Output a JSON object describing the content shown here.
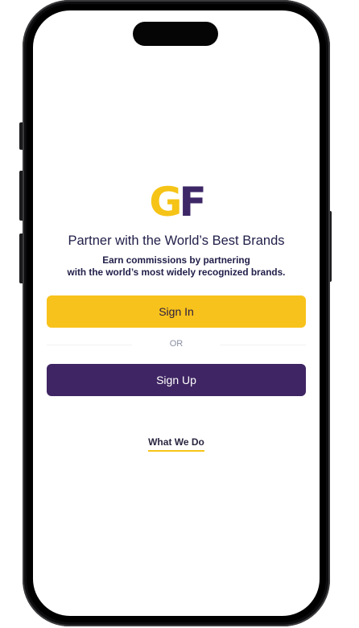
{
  "app": {
    "logo": {
      "letter_1": "G",
      "letter_2": "F"
    },
    "headline": "Partner with the World’s Best Brands",
    "subheadline_line_1": "Earn commissions by partnering",
    "subheadline_line_2": "with the world’s most widely recognized brands.",
    "sign_in_label": "Sign In",
    "or_label": "OR",
    "sign_up_label": "Sign Up",
    "what_we_do_label": "What We Do"
  },
  "colors": {
    "brand_yellow": "#f8c21c",
    "brand_purple": "#3f2563",
    "text_dark": "#22204a",
    "muted": "#8a8fa3"
  }
}
